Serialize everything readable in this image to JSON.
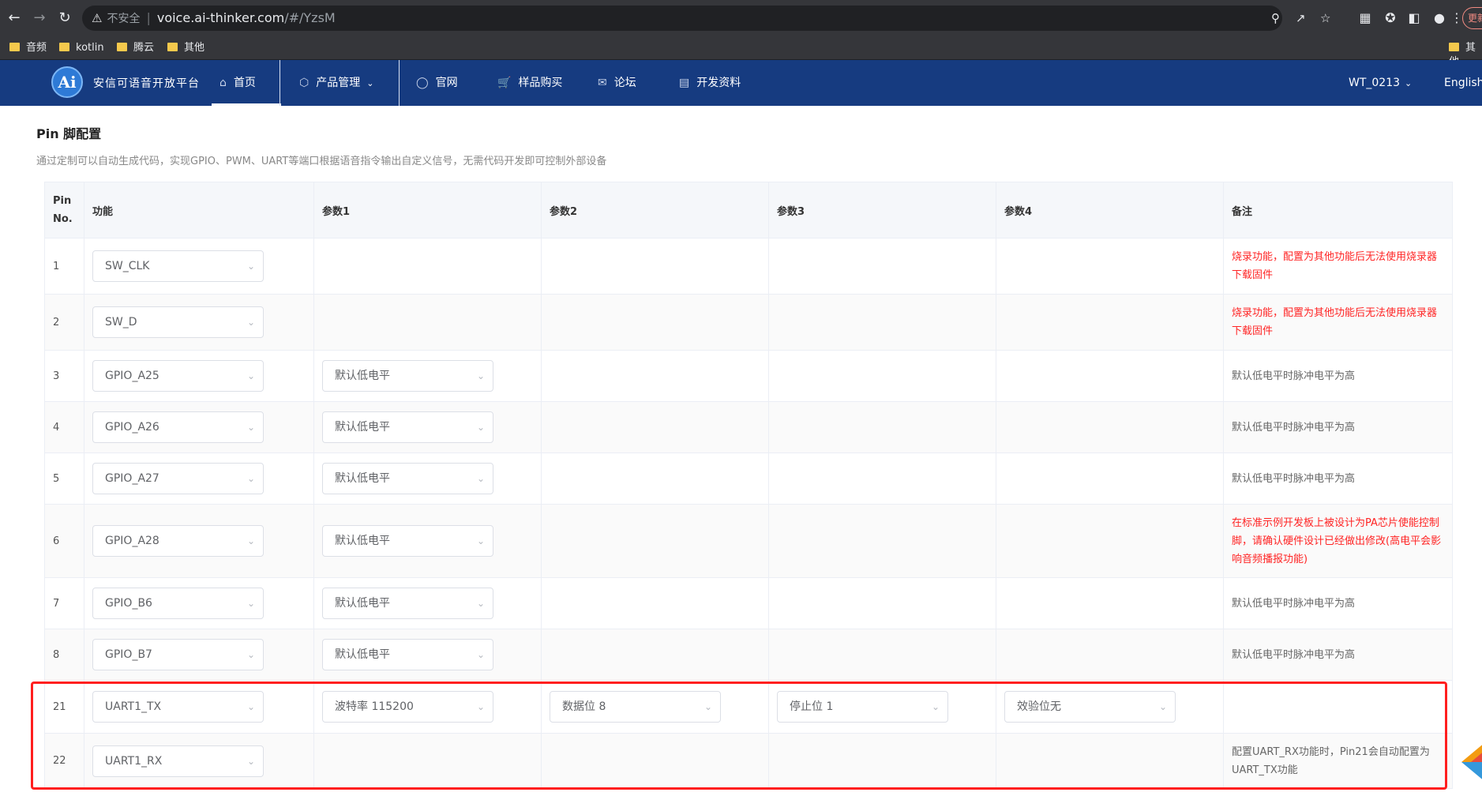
{
  "browser": {
    "security_label": "不安全",
    "url_host": "voice.ai-thinker.com",
    "url_path": "/#/YzsM",
    "update_label": "更新",
    "bookmarks": [
      "音频",
      "kotlin",
      "腾云",
      "其他"
    ],
    "bookmarks_right": "其他"
  },
  "header": {
    "logo_text": "Ai",
    "site_name": "安信可语音开放平台",
    "nav": {
      "home": "首页",
      "products": "产品管理",
      "official": "官网",
      "shop": "样品购买",
      "forum": "论坛",
      "docs": "开发资料"
    },
    "user": "WT_0213",
    "language": "English"
  },
  "page": {
    "title": "Pin 脚配置",
    "description": "通过定制可以自动生成代码，实现GPIO、PWM、UART等端口根据语音指令输出自定义信号，无需代码开发即可控制外部设备"
  },
  "table": {
    "headers": {
      "pin": "Pin No.",
      "func": "功能",
      "p1": "参数1",
      "p2": "参数2",
      "p3": "参数3",
      "p4": "参数4",
      "note": "备注"
    },
    "rows": [
      {
        "pin": "1",
        "func": "SW_CLK",
        "p1": "",
        "p2": "",
        "p3": "",
        "p4": "",
        "note": "烧录功能，配置为其他功能后无法使用烧录器下载固件",
        "note_color": "#ff2424"
      },
      {
        "pin": "2",
        "func": "SW_D",
        "p1": "",
        "p2": "",
        "p3": "",
        "p4": "",
        "note": "烧录功能，配置为其他功能后无法使用烧录器下载固件",
        "note_color": "#ff2424"
      },
      {
        "pin": "3",
        "func": "GPIO_A25",
        "p1": "默认低电平",
        "p2": "",
        "p3": "",
        "p4": "",
        "note": "默认低电平时脉冲电平为高"
      },
      {
        "pin": "4",
        "func": "GPIO_A26",
        "p1": "默认低电平",
        "p2": "",
        "p3": "",
        "p4": "",
        "note": "默认低电平时脉冲电平为高"
      },
      {
        "pin": "5",
        "func": "GPIO_A27",
        "p1": "默认低电平",
        "p2": "",
        "p3": "",
        "p4": "",
        "note": "默认低电平时脉冲电平为高"
      },
      {
        "pin": "6",
        "func": "GPIO_A28",
        "p1": "默认低电平",
        "p2": "",
        "p3": "",
        "p4": "",
        "note": "在标准示例开发板上被设计为PA芯片使能控制脚，请确认硬件设计已经做出修改(高电平会影响音频播报功能)",
        "note_color": "#ff2424"
      },
      {
        "pin": "7",
        "func": "GPIO_B6",
        "p1": "默认低电平",
        "p2": "",
        "p3": "",
        "p4": "",
        "note": "默认低电平时脉冲电平为高"
      },
      {
        "pin": "8",
        "func": "GPIO_B7",
        "p1": "默认低电平",
        "p2": "",
        "p3": "",
        "p4": "",
        "note": "默认低电平时脉冲电平为高"
      },
      {
        "pin": "21",
        "func": "UART1_TX",
        "p1": "波特率 115200",
        "p2": "数据位 8",
        "p3": "停止位 1",
        "p4": "效验位无",
        "note": ""
      },
      {
        "pin": "22",
        "func": "UART1_RX",
        "p1": "",
        "p2": "",
        "p3": "",
        "p4": "",
        "note": "配置UART_RX功能时，Pin21会自动配置为UART_TX功能"
      }
    ]
  },
  "colors": {
    "header_bg": "#163b80",
    "warning_red": "#ff2424",
    "highlight_border": "#ff1f1f"
  }
}
